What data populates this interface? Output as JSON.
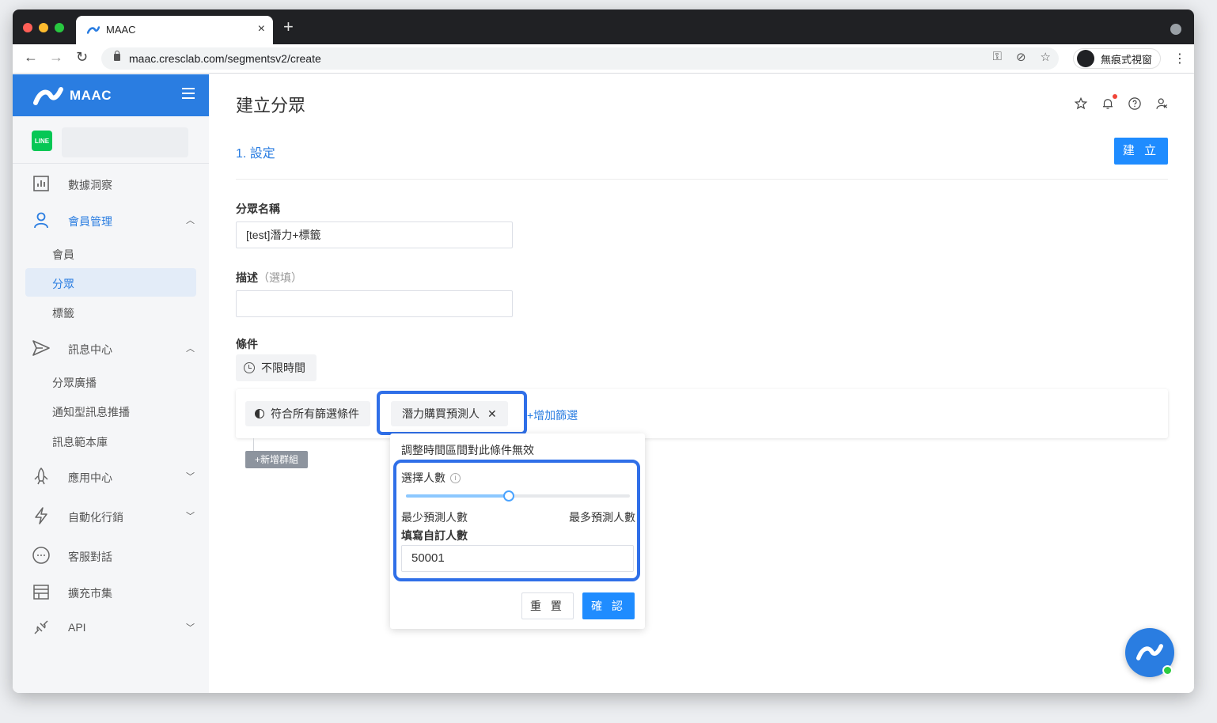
{
  "browser": {
    "tab_title": "MAAC",
    "url": "maac.cresclab.com/segmentsv2/create",
    "incognito_label": "無痕式視窗"
  },
  "sidebar": {
    "brand": "MAAC",
    "line_badge": "LINE",
    "items": [
      {
        "label": "數據洞察",
        "icon": "chart-icon"
      },
      {
        "label": "會員管理",
        "icon": "user-icon",
        "expanded": true
      },
      {
        "label": "訊息中心",
        "icon": "send-icon",
        "expanded": true
      },
      {
        "label": "應用中心",
        "icon": "rocket-icon"
      },
      {
        "label": "自動化行銷",
        "icon": "lightning-icon"
      },
      {
        "label": "客服對話",
        "icon": "chat-icon"
      },
      {
        "label": "擴充市集",
        "icon": "store-icon"
      },
      {
        "label": "API",
        "icon": "plug-icon"
      }
    ],
    "member_sub": [
      "會員",
      "分眾",
      "標籤"
    ],
    "message_sub": [
      "分眾廣播",
      "通知型訊息推播",
      "訊息範本庫"
    ]
  },
  "main": {
    "title": "建立分眾",
    "step": "1. 設定",
    "create_label": "建 立",
    "name_label": "分眾名稱",
    "name_value": "[test]潛力+標籤",
    "desc_label": "描述",
    "desc_optional": "（選填）",
    "desc_value": "",
    "condition_label": "條件",
    "time_chip": "不限時間",
    "match_chip": "符合所有篩選條件",
    "predict_chip": "潛力購買預測人",
    "add_filter": "+增加篩選",
    "add_group": "+新增群組"
  },
  "popover": {
    "note": "調整時間區間對此條件無效",
    "count_label": "選擇人數",
    "slider_value": 0.46,
    "min_label": "最少預測人數",
    "max_label": "最多預測人數",
    "custom_label": "填寫自訂人數",
    "custom_value": "50001",
    "reset_label": "重 置",
    "confirm_label": "確 認"
  },
  "colors": {
    "brand_blue": "#2a7de1",
    "primary_button": "#1f8cff",
    "highlight": "#2f6fe8",
    "line_green": "#06c755"
  }
}
